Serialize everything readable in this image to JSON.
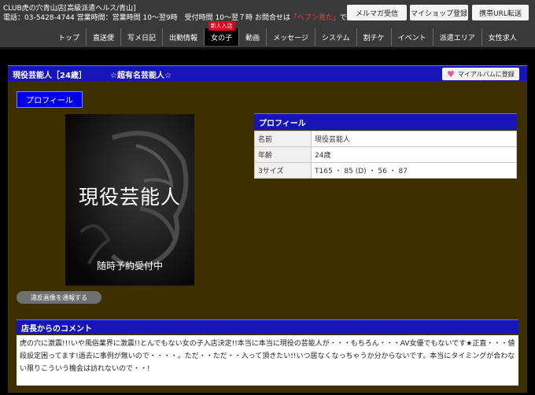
{
  "header": {
    "site_name": "CLUB虎の穴青山店[高級派遣ヘルス/青山]",
    "contact_prefix": "電話：03-5428-4744 営業時間：営業時間 10～翌9時　受付時間 10～翌７時 お問合せは",
    "contact_highlight": "「ヘブン見た」",
    "contact_suffix": "で！",
    "buttons": {
      "mail": "メルマガ受信",
      "myshop": "マイショップ登録",
      "mobile": "携帯URL転送"
    }
  },
  "nav": {
    "items": [
      "トップ",
      "直送便",
      "写メ日記",
      "出勤情報",
      "女の子",
      "動画",
      "メッセージ",
      "システム",
      "割チケ",
      "イベント",
      "派遣エリア",
      "女性求人"
    ],
    "new_badge": "新人入店"
  },
  "profile": {
    "name_header": "現役芸能人［24歳］",
    "tagline": "☆超有名芸能人☆",
    "album_button": "マイアルバムに登録",
    "profile_tab": "プロフィール",
    "photo_title": "現役芸能人",
    "photo_subtitle": "随時予約受付中",
    "report_button": "違反画像を通報する",
    "info_title": "プロフィール",
    "rows": [
      {
        "key": "名前",
        "value": "現役芸能人"
      },
      {
        "key": "年齢",
        "value": "24歳"
      },
      {
        "key": "3サイズ",
        "value": "T165 ・ 85 (D) ・ 56 ・ 87"
      }
    ]
  },
  "comment": {
    "title": "店長からのコメント",
    "text": "虎の穴に激震!!!いや風俗業界に激震!!とんでもない女の子入店決定!!本当に本当に現役の芸能人が・・・もちろん・・・AV女優でもないです★正直・・・値段設定困ってます!過去に事例が無いので・・・・。ただ・・ただ・・入って頂きたい!!いつ居なくなっちゃうか分からないです。本当にタイミングが合わない限りこういう機会は訪れないので・・!"
  },
  "colors": {
    "header_bg": "#3a3a3a",
    "panel_bg": "#3e2f00",
    "bar_blue": "#1616b8",
    "tab_blue": "#0000e8",
    "highlight_red": "#ff3b3b"
  }
}
